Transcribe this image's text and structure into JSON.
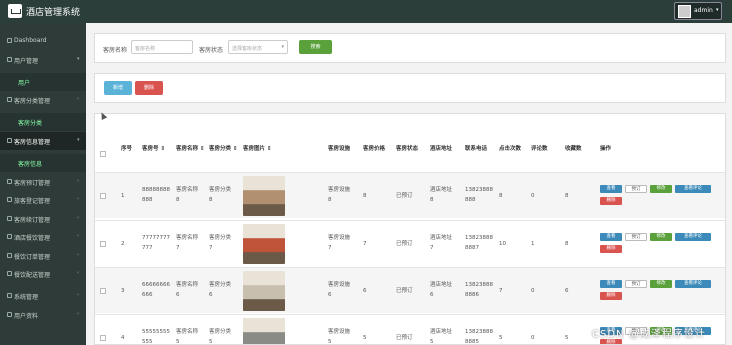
{
  "app": {
    "title": "酒店管理系统",
    "user": "admin"
  },
  "sidebar": {
    "items": [
      {
        "label": "Dashboard",
        "arrow": "",
        "sub": false,
        "active": false
      },
      {
        "label": "用户管理",
        "arrow": "▾",
        "sub": false,
        "active": false
      },
      {
        "label": "用户",
        "arrow": "",
        "sub": true,
        "active": false
      },
      {
        "label": "客房分类管理",
        "arrow": "‹",
        "sub": false,
        "active": false
      },
      {
        "label": "客房分类",
        "arrow": "",
        "sub": true,
        "active": false
      },
      {
        "label": "客房信息管理",
        "arrow": "▾",
        "sub": false,
        "active": true
      },
      {
        "label": "客房信息",
        "arrow": "",
        "sub": true,
        "active": false
      },
      {
        "label": "客房预订管理",
        "arrow": "‹",
        "sub": false,
        "active": false
      },
      {
        "label": "旅客登记管理",
        "arrow": "‹",
        "sub": false,
        "active": false
      },
      {
        "label": "客房续订管理",
        "arrow": "‹",
        "sub": false,
        "active": false
      },
      {
        "label": "酒店餐饮管理",
        "arrow": "‹",
        "sub": false,
        "active": false
      },
      {
        "label": "餐饮订单管理",
        "arrow": "‹",
        "sub": false,
        "active": false
      },
      {
        "label": "餐饮配送管理",
        "arrow": "‹",
        "sub": false,
        "active": false
      },
      {
        "label": "系统管理",
        "arrow": "‹",
        "sub": false,
        "active": false
      },
      {
        "label": "用户资料",
        "arrow": "‹",
        "sub": false,
        "active": false
      }
    ]
  },
  "search": {
    "name_label": "客房名称",
    "name_placeholder": "客房名称",
    "status_label": "客房状态",
    "status_placeholder": "选择客房状态",
    "search_button": "搜索"
  },
  "toolbar": {
    "add_label": "新增",
    "delete_label": "删除"
  },
  "table": {
    "headers": [
      "序号",
      "客房号",
      "客房名称",
      "客房分类",
      "客房图片",
      "客房设施",
      "客房价格",
      "客房状态",
      "酒店地址",
      "联系电话",
      "点击次数",
      "评论数",
      "收藏数",
      "操作"
    ],
    "sort_mark": "⇕",
    "rows": [
      {
        "idx": "1",
        "room_no": [
          "88888888",
          "888"
        ],
        "name": [
          "客房名称",
          "8"
        ],
        "category": [
          "客房分类",
          "8"
        ],
        "facility": [
          "客房设施",
          "8"
        ],
        "price": "8",
        "status": "已预订",
        "address": [
          "酒店地址",
          "8"
        ],
        "phone": [
          "13823888",
          "888"
        ],
        "clicks": "8",
        "comments": "0",
        "favorites": "8",
        "thumb": "#b09070"
      },
      {
        "idx": "2",
        "room_no": [
          "77777777",
          "777"
        ],
        "name": [
          "客房名称",
          "7"
        ],
        "category": [
          "客房分类",
          "7"
        ],
        "facility": [
          "客房设施",
          "7"
        ],
        "price": "7",
        "status": "已预订",
        "address": [
          "酒店地址",
          "7"
        ],
        "phone": [
          "13823888",
          "8887"
        ],
        "clicks": "10",
        "comments": "1",
        "favorites": "8",
        "thumb": "#c0543a"
      },
      {
        "idx": "3",
        "room_no": [
          "66666666",
          "666"
        ],
        "name": [
          "客房名称",
          "6"
        ],
        "category": [
          "客房分类",
          "6"
        ],
        "facility": [
          "客房设施",
          "6"
        ],
        "price": "6",
        "status": "已预订",
        "address": [
          "酒店地址",
          "6"
        ],
        "phone": [
          "13823888",
          "8886"
        ],
        "clicks": "7",
        "comments": "0",
        "favorites": "6",
        "thumb": "#c8bfae"
      },
      {
        "idx": "4",
        "room_no": [
          "55555555",
          "555"
        ],
        "name": [
          "客房名称",
          "5"
        ],
        "category": [
          "客房分类",
          "5"
        ],
        "facility": [
          "客房设施",
          "5"
        ],
        "price": "5",
        "status": "已预订",
        "address": [
          "酒店地址",
          "5"
        ],
        "phone": [
          "13823888",
          "8885"
        ],
        "clicks": "5",
        "comments": "0",
        "favorites": "5",
        "thumb": "#8a8a86"
      }
    ],
    "actions": {
      "view": "查看",
      "book": "预订",
      "edit": "修改",
      "review": "查看评论",
      "delete": "删除"
    }
  },
  "watermark": "CSDN @成泽程序设计",
  "colors": {
    "topbar": "#2c3e3a",
    "sidebar": "#2f3b38",
    "search_btn": "#5aa13c",
    "add_btn": "#5bb3d8",
    "delete_btn": "#d9534f",
    "view_btn": "#3b8ab9",
    "edit_btn": "#5aa13c",
    "review_btn": "#3b8ab9"
  }
}
